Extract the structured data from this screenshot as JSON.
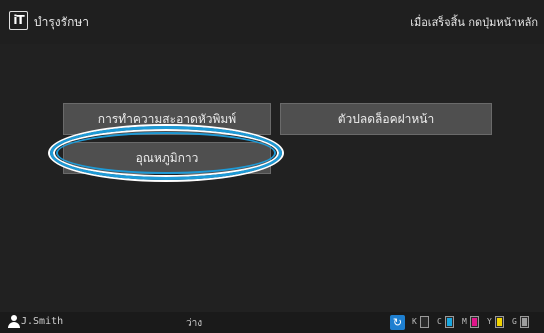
{
  "header": {
    "app_icon_text": "iT",
    "title": "บำรุงรักษา",
    "hint": "เมื่อเสร็จสิ้น กดปุ่มหน้าหลัก"
  },
  "buttons": [
    {
      "label": "การทำความสะอาดหัวพิมพ์"
    },
    {
      "label": "ตัวปลดล็อคฝาหน้า"
    },
    {
      "label": "อุณหภูมิกาว"
    }
  ],
  "status": {
    "user": "J.Smith",
    "state": "ว่าง",
    "network_icon": "refresh-icon"
  },
  "inks": [
    {
      "label": "K",
      "color": "#2a2a2a",
      "level": 0
    },
    {
      "label": "C",
      "color": "#19a7e0",
      "level": 1
    },
    {
      "label": "M",
      "color": "#e0168a",
      "level": 1
    },
    {
      "label": "Y",
      "color": "#f2d400",
      "level": 1
    },
    {
      "label": "G",
      "color": "#9e9e9e",
      "level": 1
    }
  ],
  "colors": {
    "highlight": "#1e9ad6",
    "button_bg": "#4f4f4f"
  }
}
